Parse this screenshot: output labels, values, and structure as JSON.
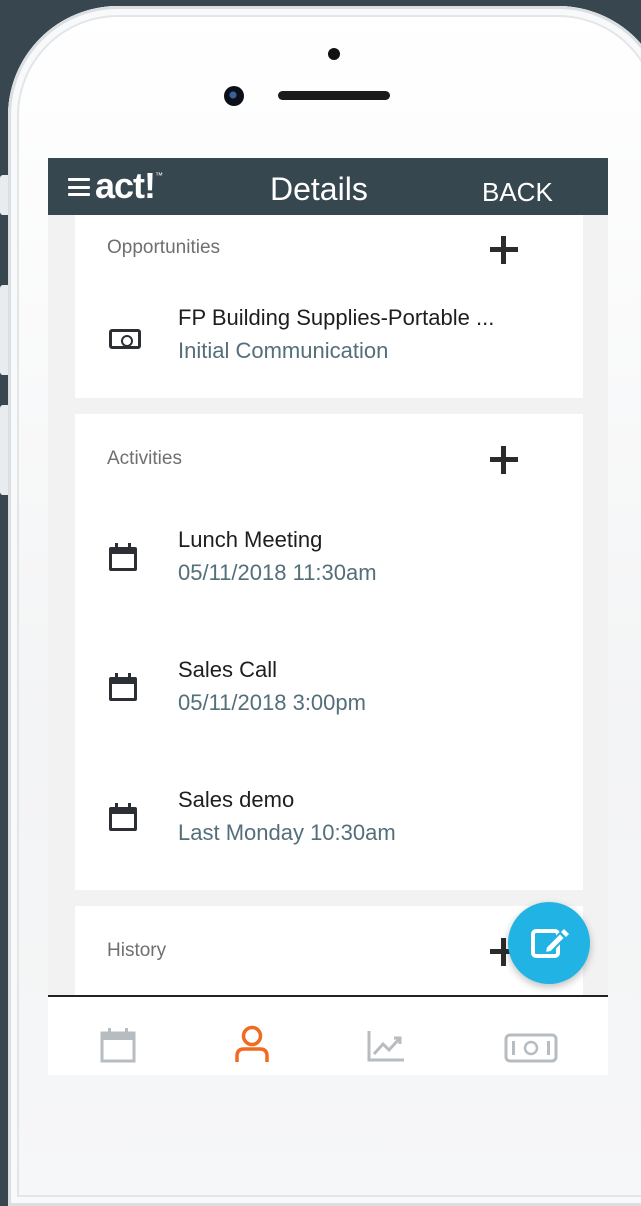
{
  "header": {
    "brand": "act!",
    "brand_mark": "™",
    "title": "Details",
    "back_label": "BACK"
  },
  "opportunities": {
    "title": "Opportunities",
    "items": [
      {
        "name": "FP Building Supplies-Portable ...",
        "stage": "Initial Communication",
        "icon": "money-icon"
      }
    ]
  },
  "activities": {
    "title": "Activities",
    "items": [
      {
        "name": "Lunch Meeting",
        "when": "05/11/2018 11:30am",
        "icon": "calendar-icon"
      },
      {
        "name": "Sales Call",
        "when": "05/11/2018 3:00pm",
        "icon": "calendar-icon"
      },
      {
        "name": "Sales demo",
        "when": "Last Monday 10:30am",
        "icon": "calendar-icon"
      }
    ]
  },
  "history": {
    "title": "History"
  },
  "bottom_nav": [
    {
      "name": "calendar-icon",
      "active": false
    },
    {
      "name": "contact-icon",
      "active": true
    },
    {
      "name": "trend-chart-icon",
      "active": false
    },
    {
      "name": "money-icon",
      "active": false
    }
  ],
  "colors": {
    "topbar": "#37474f",
    "accent_orange": "#f26a21",
    "fab": "#22b3e5",
    "secondary_text": "#546e7a"
  }
}
